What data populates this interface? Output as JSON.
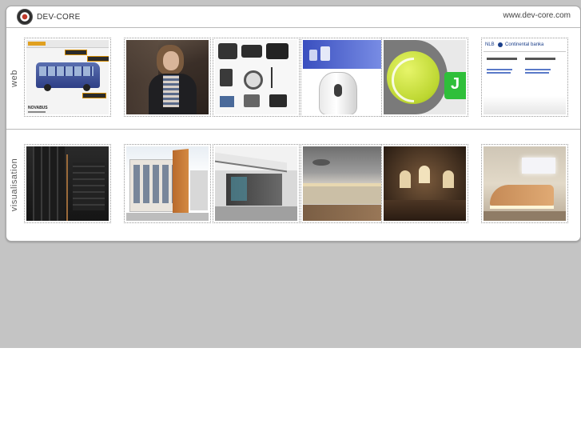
{
  "header": {
    "logo_text": "DEV-CORE",
    "site_url": "www.dev-core.com"
  },
  "rows": {
    "web_label": "web",
    "visualisation_label": "visualisation"
  },
  "web_thumbs": [
    {
      "name": "novabus",
      "caption": "NOVABUS"
    },
    {
      "name": "fashion-photo"
    },
    {
      "name": "camera-shop"
    },
    {
      "name": "dispenser-product"
    },
    {
      "name": "tennis-logo"
    },
    {
      "name": "nlb-bank",
      "brand": "NLB",
      "bank_name": "Continental banka"
    }
  ],
  "vis_thumbs": [
    {
      "name": "dark-facade"
    },
    {
      "name": "building-exterior"
    },
    {
      "name": "glass-pavilion"
    },
    {
      "name": "terrace-render"
    },
    {
      "name": "arched-hall"
    },
    {
      "name": "reception-interior"
    }
  ],
  "colors": {
    "page_bg": "#c4c4c4",
    "panel_bg": "#ffffff",
    "logo_accent": "#c0392b"
  }
}
